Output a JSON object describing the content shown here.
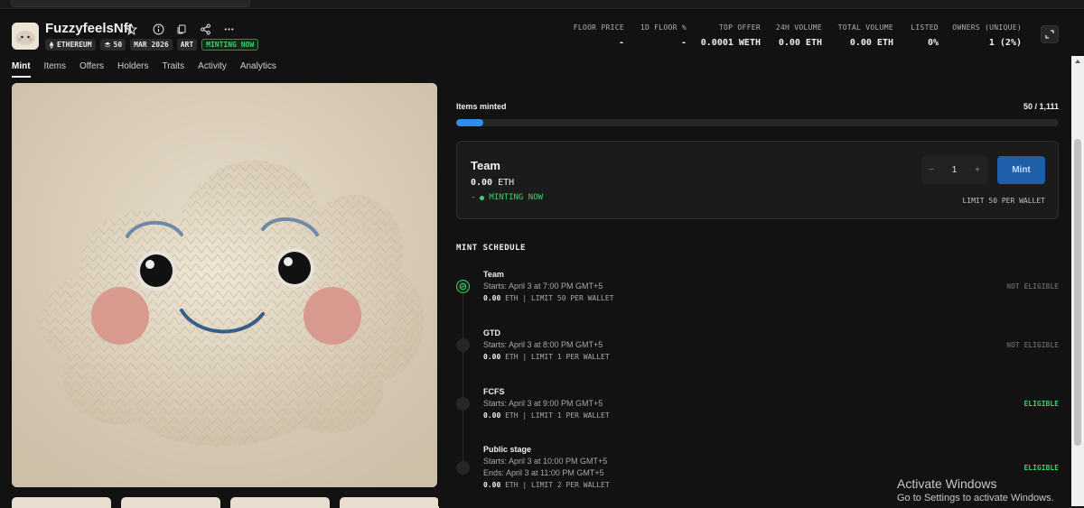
{
  "collection": {
    "name": "FuzzyfeelsNft",
    "badges": {
      "chain": "ETHEREUM",
      "supply": "50",
      "date": "MAR 2026",
      "category": "ART",
      "status": "MINTING NOW"
    }
  },
  "stats": [
    {
      "label": "FLOOR PRICE",
      "value": "-"
    },
    {
      "label": "1D FLOOR %",
      "value": "-"
    },
    {
      "label": "TOP OFFER",
      "value": "0.0001 WETH"
    },
    {
      "label": "24H VOLUME",
      "value": "0.00 ETH"
    },
    {
      "label": "TOTAL VOLUME",
      "value": "0.00 ETH"
    },
    {
      "label": "LISTED",
      "value": "0%"
    },
    {
      "label": "OWNERS (UNIQUE)",
      "value": "1 (2%)"
    }
  ],
  "tabs": [
    "Mint",
    "Items",
    "Offers",
    "Holders",
    "Traits",
    "Activity",
    "Analytics"
  ],
  "mint": {
    "items_minted_label": "Items minted",
    "items_minted_count": "50 / 1,111",
    "progress_fraction": 0.045,
    "current_stage": {
      "name": "Team",
      "price": "0.00",
      "currency": "ETH",
      "dash": "-",
      "status": "MINTING NOW",
      "quantity": "1",
      "minus": "−",
      "plus": "+",
      "mint_label": "Mint",
      "limit": "LIMIT 50 PER WALLET"
    },
    "schedule_title": "MINT SCHEDULE",
    "stages": [
      {
        "name": "Team",
        "starts": "Starts: April 3 at 7:00 PM GMT+5",
        "ends": "",
        "price": "0.00",
        "detail": " ETH | LIMIT 50 PER WALLET",
        "eligibility": "NOT ELIGIBLE"
      },
      {
        "name": "GTD",
        "starts": "Starts: April 3 at 8:00 PM GMT+5",
        "ends": "",
        "price": "0.00",
        "detail": " ETH | LIMIT 1 PER WALLET",
        "eligibility": "NOT ELIGIBLE"
      },
      {
        "name": "FCFS",
        "starts": "Starts: April 3 at 9:00 PM GMT+5",
        "ends": "",
        "price": "0.00",
        "detail": " ETH | LIMIT 1 PER WALLET",
        "eligibility": "ELIGIBLE"
      },
      {
        "name": "Public stage",
        "starts": "Starts: April 3 at 10:00 PM GMT+5",
        "ends": "Ends: April 3 at 11:00 PM GMT+5",
        "price": "0.00",
        "detail": " ETH | LIMIT 2 PER WALLET",
        "eligibility": "ELIGIBLE"
      }
    ]
  },
  "overlay": {
    "activate_title": "Activate Windows",
    "activate_sub": "Go to Settings to activate Windows."
  },
  "colors": {
    "accent_green": "#3fcf6a",
    "mint_button": "#1f5ea8",
    "progress": "#2f8fea",
    "background": "#121212"
  }
}
